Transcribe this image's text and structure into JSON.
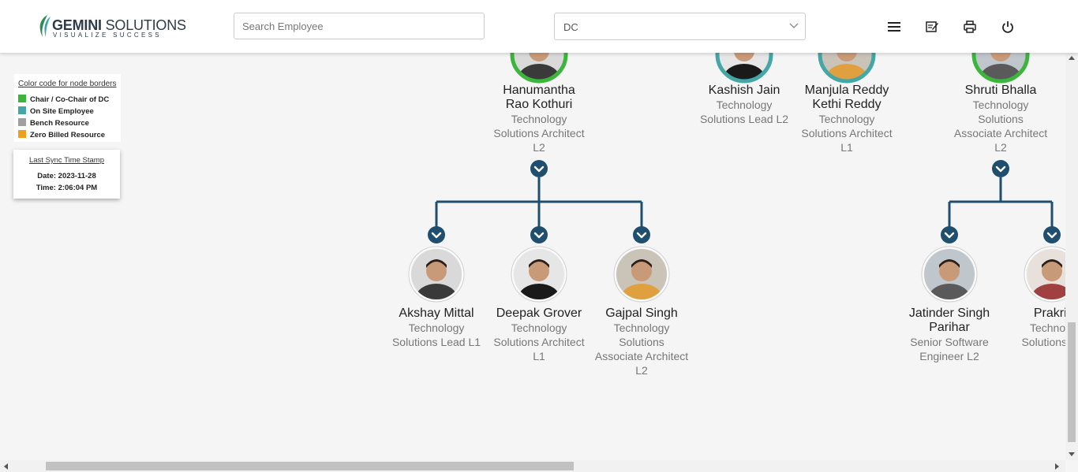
{
  "header": {
    "logo_title_bold": "GEMINI",
    "logo_title_rest": " SOLUTIONS",
    "logo_subtitle": "VISUALIZE SUCCESS",
    "search": {
      "placeholder": "Search Employee",
      "value": ""
    },
    "dc_select": {
      "value": "DC"
    },
    "icons": [
      "menu-icon",
      "edit-note-icon",
      "print-icon",
      "power-icon"
    ]
  },
  "legend": {
    "title": "Color code for node borders",
    "items": [
      {
        "label": "Chair / Co-Chair of DC",
        "color": "#3cb53c"
      },
      {
        "label": "On Site Employee",
        "color": "#44a6a6"
      },
      {
        "label": "Bench Resource",
        "color": "#a0a0a0"
      },
      {
        "label": "Zero Billed Resource",
        "color": "#f0a01e"
      }
    ]
  },
  "sync": {
    "title": "Last Sync Time Stamp",
    "date": "Date: 2023-11-28",
    "time": "Time: 2:06:04 PM"
  },
  "colors": {
    "connector": "#1f4e6e",
    "green": "#3cb53c",
    "teal": "#44a6a6"
  },
  "top_nodes": [
    {
      "name_lines": [
        "Hanumantha",
        "Rao Kothuri"
      ],
      "role_lines": [
        "Technology",
        "Solutions Architect",
        "L2"
      ],
      "border": "green",
      "expanded": true
    },
    {
      "name_lines": [
        "Kashish Jain"
      ],
      "role_lines": [
        "Technology",
        "Solutions Lead L2"
      ],
      "border": "teal",
      "expanded": false
    },
    {
      "name_lines": [
        "Manjula Reddy",
        "Kethi Reddy"
      ],
      "role_lines": [
        "Technology",
        "Solutions Architect",
        "L1"
      ],
      "border": "teal",
      "expanded": false
    },
    {
      "name_lines": [
        "Shruti Bhalla"
      ],
      "role_lines": [
        "Technology",
        "Solutions",
        "Associate Architect",
        "L2"
      ],
      "border": "green",
      "expanded": true
    }
  ],
  "child_nodes": [
    {
      "name_lines": [
        "Akshay Mittal"
      ],
      "role_lines": [
        "Technology",
        "Solutions Lead L1"
      ],
      "parent": 0
    },
    {
      "name_lines": [
        "Deepak Grover"
      ],
      "role_lines": [
        "Technology",
        "Solutions Architect",
        "L1"
      ],
      "parent": 0
    },
    {
      "name_lines": [
        "Gajpal Singh"
      ],
      "role_lines": [
        "Technology",
        "Solutions",
        "Associate Architect",
        "L2"
      ],
      "parent": 0
    },
    {
      "name_lines": [
        "Jatinder Singh",
        "Parihar"
      ],
      "role_lines": [
        "Senior Software",
        "Engineer L2"
      ],
      "parent": 3
    },
    {
      "name_lines": [
        "Prakrit"
      ],
      "role_lines": [
        "Technolo",
        "Solutions Le"
      ],
      "parent": 3
    }
  ]
}
